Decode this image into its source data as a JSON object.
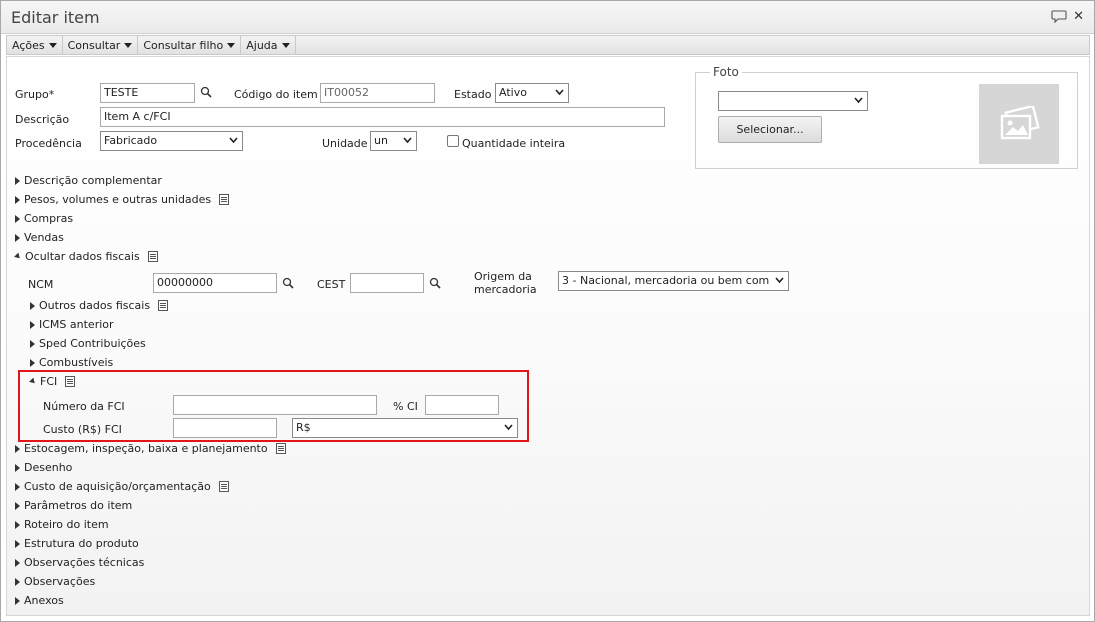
{
  "window": {
    "title": "Editar item"
  },
  "menubar": {
    "items": [
      {
        "label": "Ações"
      },
      {
        "label": "Consultar"
      },
      {
        "label": "Consultar filho"
      },
      {
        "label": "Ajuda"
      }
    ]
  },
  "form": {
    "grupo_label": "Grupo*",
    "grupo_value": "TESTE",
    "codigo_label": "Código do item",
    "codigo_value": "IT00052",
    "estado_label": "Estado",
    "estado_value": "Ativo",
    "descricao_label": "Descrição",
    "descricao_value": "Item A c/FCI",
    "procedencia_label": "Procedência",
    "procedencia_value": "Fabricado",
    "unidade_label": "Unidade",
    "unidade_value": "un",
    "quantidade_label": "Quantidade inteira",
    "quantidade_checked": false
  },
  "foto": {
    "legend": "Foto",
    "select_value": "",
    "button_label": "Selecionar..."
  },
  "sections_top": [
    {
      "label": "Descrição complementar",
      "has_doc_icon": false
    },
    {
      "label": "Pesos, volumes e outras unidades",
      "has_doc_icon": true
    },
    {
      "label": "Compras",
      "has_doc_icon": false
    },
    {
      "label": "Vendas",
      "has_doc_icon": false
    },
    {
      "label": "Ocultar dados fiscais",
      "has_doc_icon": true,
      "expanded": true
    }
  ],
  "fiscal": {
    "ncm_label": "NCM",
    "ncm_value": "00000000",
    "cest_label": "CEST",
    "cest_value": "",
    "origem_label_1": "Origem da",
    "origem_label_2": "mercadoria",
    "origem_value": "3 - Nacional, mercadoria ou bem com",
    "subsections": [
      {
        "label": "Outros dados fiscais",
        "has_doc_icon": true
      },
      {
        "label": "ICMS anterior",
        "has_doc_icon": false
      },
      {
        "label": "Sped Contribuições",
        "has_doc_icon": false
      },
      {
        "label": "Combustíveis",
        "has_doc_icon": false
      }
    ]
  },
  "fci": {
    "label": "FCI",
    "numero_label": "Número da FCI",
    "numero_value": "",
    "ci_label": "% CI",
    "ci_value": "",
    "custo_label": "Custo (R$) FCI",
    "custo_value": "",
    "moeda_value": "R$",
    "highlight_color": "#e0161b"
  },
  "sections_bottom": [
    {
      "label": "Estocagem, inspeção, baixa e planejamento",
      "has_doc_icon": true
    },
    {
      "label": "Desenho",
      "has_doc_icon": false
    },
    {
      "label": "Custo de aquisição/orçamentação",
      "has_doc_icon": true
    },
    {
      "label": "Parâmetros do item",
      "has_doc_icon": false
    },
    {
      "label": "Roteiro do item",
      "has_doc_icon": false
    },
    {
      "label": "Estrutura do produto",
      "has_doc_icon": false
    },
    {
      "label": "Observações técnicas",
      "has_doc_icon": false
    },
    {
      "label": "Observações",
      "has_doc_icon": false
    },
    {
      "label": "Anexos",
      "has_doc_icon": false
    }
  ]
}
